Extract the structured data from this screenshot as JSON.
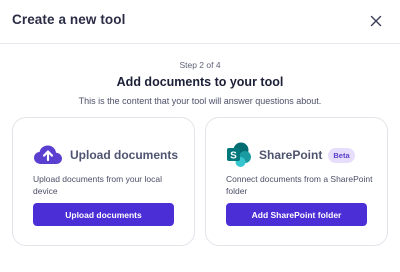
{
  "dialog": {
    "title": "Create a new tool"
  },
  "stepper": {
    "text": "Step 2 of 4"
  },
  "main": {
    "heading": "Add documents to your tool",
    "subtitle": "This is the content that your tool will answer questions about."
  },
  "cards": {
    "upload": {
      "icon": "cloud-upload-icon",
      "title": "Upload documents",
      "description": "Upload documents from your local device",
      "button_label": "Upload documents"
    },
    "sharepoint": {
      "icon": "sharepoint-logo",
      "title": "SharePoint",
      "badge": "Beta",
      "description": "Connect documents from a SharePoint folder",
      "button_label": "Add SharePoint folder"
    }
  },
  "colors": {
    "accent": "#4b2ed6",
    "badge_bg": "#e7defc",
    "sharepoint_green": "#0b6e65"
  }
}
